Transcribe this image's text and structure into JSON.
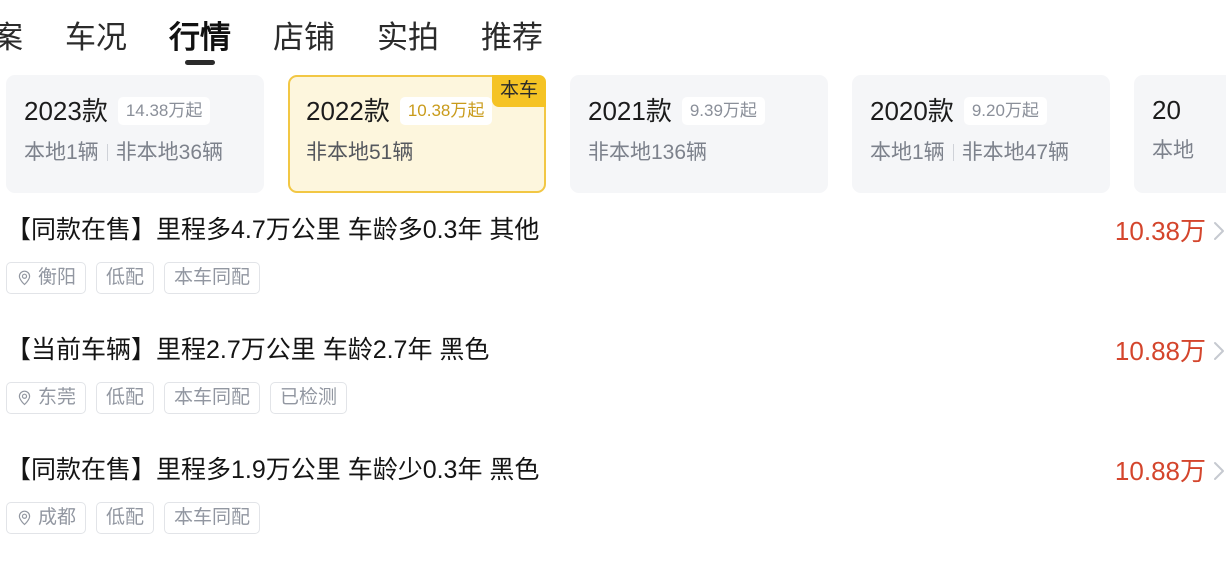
{
  "nav": {
    "items": [
      {
        "label": "案",
        "active": false
      },
      {
        "label": "车况",
        "active": false
      },
      {
        "label": "行情",
        "active": true
      },
      {
        "label": "店铺",
        "active": false
      },
      {
        "label": "实拍",
        "active": false
      },
      {
        "label": "推荐",
        "active": false
      }
    ]
  },
  "year_cards": [
    {
      "year": "2023款",
      "price_from": "14.38万起",
      "local": "本地1辆",
      "nonlocal": "非本地36辆",
      "has_separator": true,
      "selected": false,
      "badge": ""
    },
    {
      "year": "2022款",
      "price_from": "10.38万起",
      "local": "",
      "nonlocal": "非本地51辆",
      "has_separator": false,
      "selected": true,
      "badge": "本车"
    },
    {
      "year": "2021款",
      "price_from": "9.39万起",
      "local": "",
      "nonlocal": "非本地136辆",
      "has_separator": false,
      "selected": false,
      "badge": ""
    },
    {
      "year": "2020款",
      "price_from": "9.20万起",
      "local": "本地1辆",
      "nonlocal": "非本地47辆",
      "has_separator": true,
      "selected": false,
      "badge": ""
    },
    {
      "year": "20",
      "price_from": "",
      "local": "本地",
      "nonlocal": "",
      "has_separator": false,
      "selected": false,
      "badge": ""
    }
  ],
  "listings": [
    {
      "title": "【同款在售】里程多4.7万公里 车龄多0.3年 其他",
      "city": "衡阳",
      "tags": [
        "低配",
        "本车同配"
      ],
      "price": "10.38万"
    },
    {
      "title": "【当前车辆】里程2.7万公里 车龄2.7年 黑色",
      "city": "东莞",
      "tags": [
        "低配",
        "本车同配",
        "已检测"
      ],
      "price": "10.88万"
    },
    {
      "title": "【同款在售】里程多1.9万公里 车龄少0.3年 黑色",
      "city": "成都",
      "tags": [
        "低配",
        "本车同配"
      ],
      "price": "10.88万"
    }
  ],
  "colors": {
    "accent_price": "#d4452c",
    "selected_card_bg": "#fdf6dd",
    "selected_card_border": "#f2c744",
    "badge_bg": "#f5c324",
    "card_bg": "#f5f6f8"
  }
}
